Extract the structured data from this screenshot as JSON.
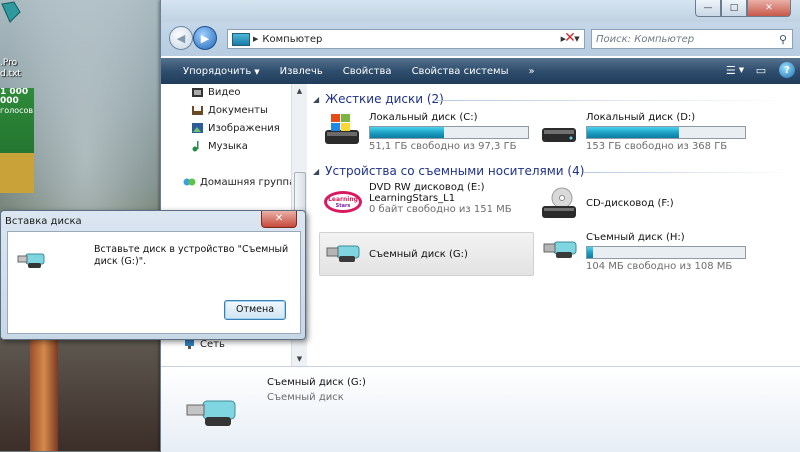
{
  "desktop": {
    "label_lines": [
      ".Pro",
      "d.txt"
    ],
    "poster_lines": [
      "1 000 000",
      "голосов"
    ]
  },
  "titlebar": {
    "minimize": "—",
    "maximize": "□",
    "close": "✕"
  },
  "address": {
    "location": "Компьютер",
    "search_placeholder": "Поиск: Компьютер"
  },
  "toolbar": {
    "items": [
      "Упорядочить",
      "Извлечь",
      "Свойства",
      "Свойства системы"
    ],
    "more": "»"
  },
  "navpane": {
    "items": [
      "Видео",
      "Документы",
      "Изображения",
      "Музыка",
      "Домашняя группа",
      "Сеть"
    ]
  },
  "content": {
    "groups": [
      {
        "title": "Жесткие диски (2)"
      },
      {
        "title": "Устройства со съемными носителями (4)"
      }
    ],
    "drives": [
      {
        "name": "Локальный диск (C:)",
        "free": "51,1 ГБ свободно из 97,3 ГБ",
        "used_fraction": 0.47
      },
      {
        "name": "Локальный диск (D:)",
        "free": "153 ГБ свободно из 368 ГБ",
        "used_fraction": 0.58
      },
      {
        "name": "DVD RW дисковод (E:)",
        "label": "LearningStars_L1",
        "free": "0 байт свободно из 151 МБ"
      },
      {
        "name": "CD-дисковод (F:)"
      },
      {
        "name": "Съемный диск (G:)"
      },
      {
        "name": "Съемный диск (H:)",
        "free": "104 МБ свободно из 108 МБ",
        "used_fraction": 0.04
      }
    ],
    "learning_logo": "Learning Stars"
  },
  "details": {
    "title": "Съемный диск (G:)",
    "subtitle": "Съемный диск"
  },
  "dialog": {
    "title": "Вставка диска",
    "message": "Вставьте диск в устройство \"Съемный диск (G:)\".",
    "cancel": "Отмена",
    "close": "✕"
  },
  "colors": {
    "toolbar": "#2f4d6c",
    "group_header": "#1e3287",
    "drive_bar": "#1a9cc1"
  }
}
